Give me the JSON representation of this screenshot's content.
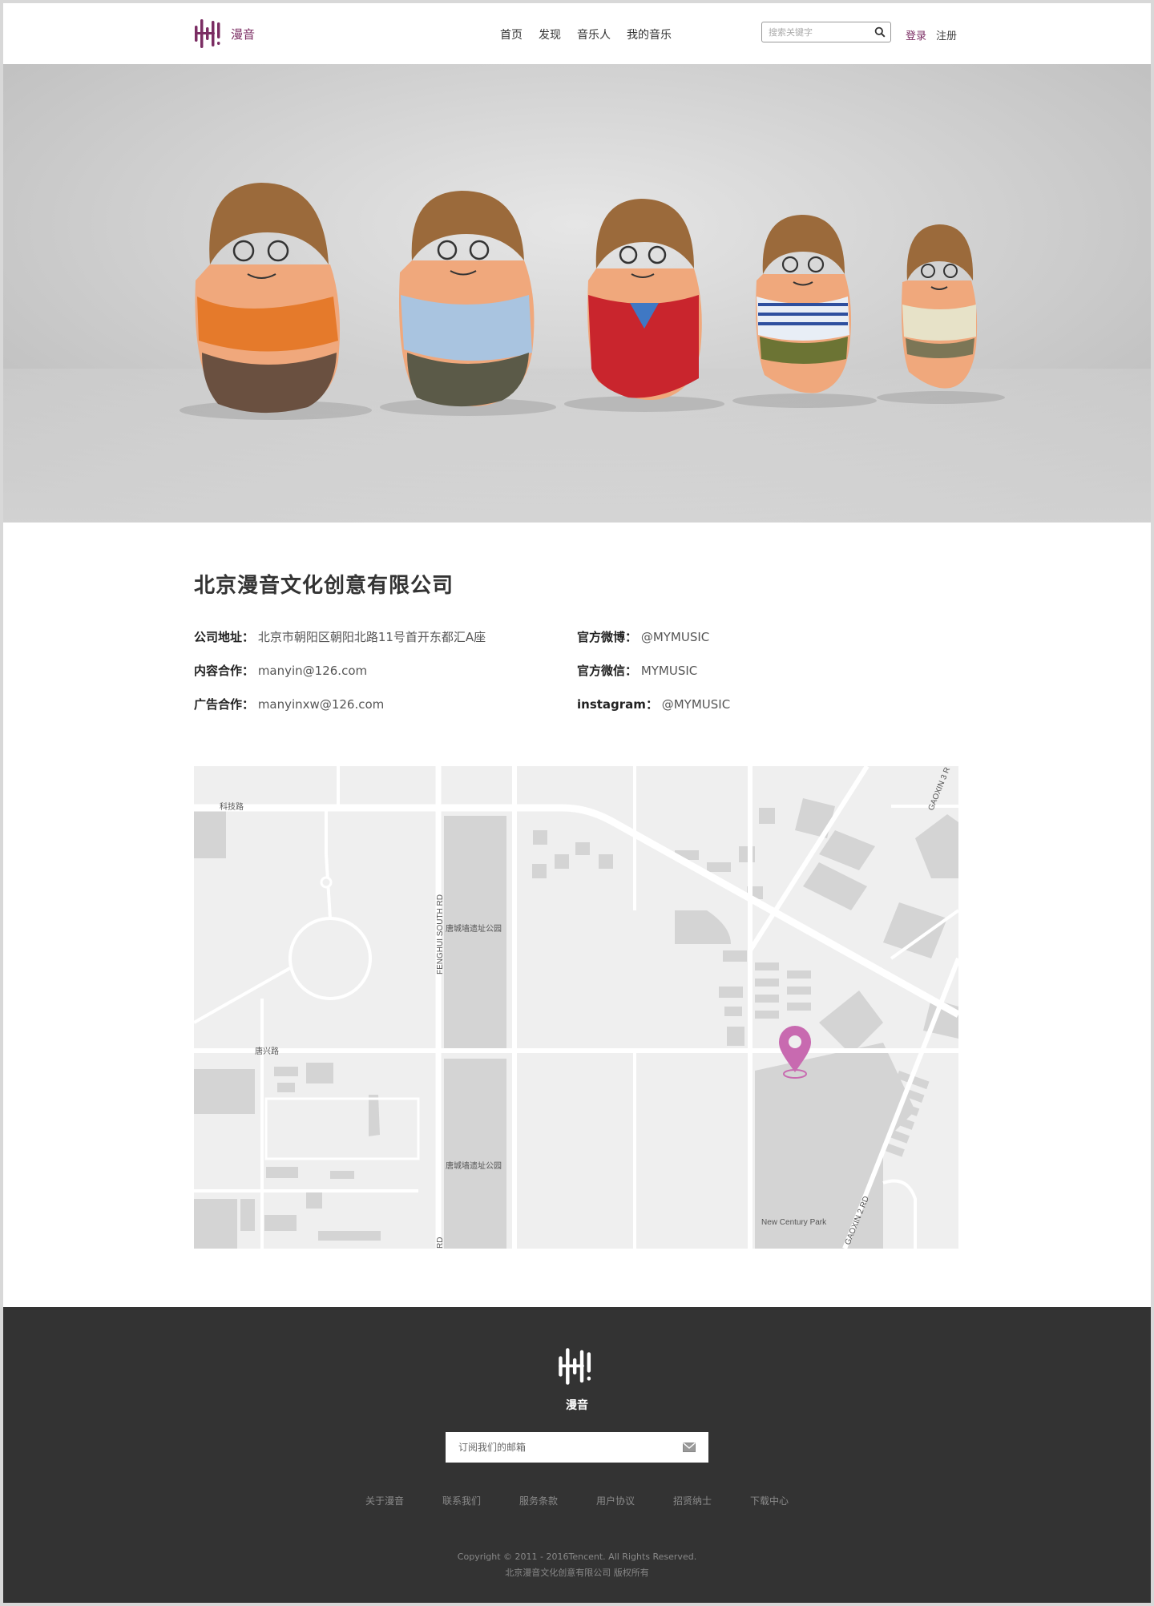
{
  "header": {
    "brand": "漫音",
    "nav": [
      "首页",
      "发现",
      "音乐人",
      "我的音乐"
    ],
    "search_placeholder": "搜索关键字",
    "login": "登录",
    "register": "注册"
  },
  "company": {
    "name": "北京漫音文化创意有限公司",
    "left": [
      {
        "label": "公司地址",
        "value": "北京市朝阳区朝阳北路11号首开东都汇A座"
      },
      {
        "label": "内容合作",
        "value": "manyin@126.com"
      },
      {
        "label": "广告合作",
        "value": "manyinxw@126.com"
      }
    ],
    "right": [
      {
        "label": "官方微博",
        "value": "@MYMUSIC"
      },
      {
        "label": "官方微信",
        "value": "MYMUSIC"
      },
      {
        "label": "instagram",
        "value": "@MYMUSIC"
      }
    ],
    "separator": "："
  },
  "map": {
    "labels": {
      "keji": "科技路",
      "fenghui": "FENGHUI SOUTH RD",
      "park1": "唐城墙遗址公园",
      "tangxing": "唐兴路",
      "park2": "唐城墙遗址公园",
      "rd": "RD",
      "newcentury": "New Century Park",
      "gaoxin2": "GAOXIN 2 RD",
      "gaoxin3": "GAOXIN 3 R"
    },
    "pin_color": "#c86ab0"
  },
  "footer": {
    "brand": "漫音",
    "subscribe_placeholder": "订阅我们的邮箱",
    "links": [
      "关于漫音",
      "联系我们",
      "服务条款",
      "用户协议",
      "招贤纳士",
      "下载中心"
    ],
    "copyright": "Copyright © 2011 - 2016Tencent. All Rights Reserved.",
    "company": "北京漫音文化创意有限公司 版权所有"
  },
  "colors": {
    "accent": "#7b2d63",
    "footer_bg": "#333333"
  }
}
